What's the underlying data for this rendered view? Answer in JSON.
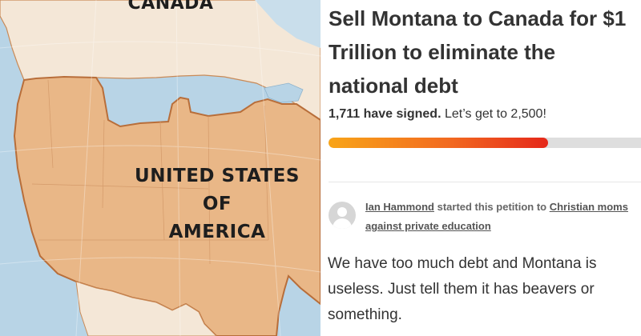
{
  "map": {
    "label_north": "CANADA",
    "label_south": [
      "UNITED STATES",
      "OF",
      "AMERICA"
    ]
  },
  "petition": {
    "title": "Sell Montana to Canada for $1 Trillion to eliminate the national debt",
    "signed_count_text": "1,711 have signed.",
    "goal_text": "Let’s get to 2,500!",
    "signed": 1711,
    "goal": 2500,
    "starter_name": "Ian Hammond",
    "starter_verb": "started this petition to",
    "recipient": "Christian moms against private education",
    "description": "We have too much debt and Montana is useless. Just tell them it has beavers or something."
  },
  "colors": {
    "progress_start": "#f8a418",
    "progress_end": "#e5281a",
    "usa_fill": "#e9b787",
    "canada_fill": "#f4e7d7",
    "water": "#b8d4e6"
  }
}
